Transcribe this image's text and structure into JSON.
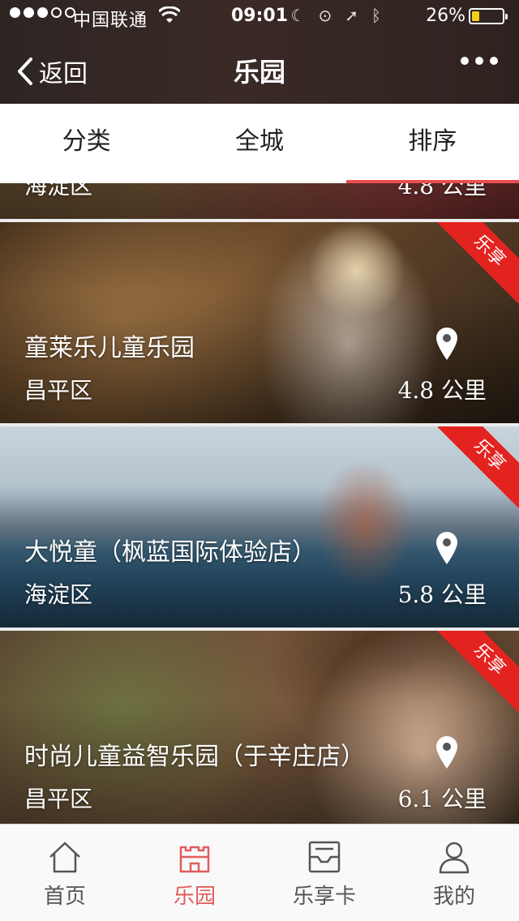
{
  "status_bar": {
    "carrier": "中国联通",
    "time": "09:01",
    "battery": "26%",
    "battery_level": 0.26
  },
  "nav": {
    "back_label": "返回",
    "title": "乐园"
  },
  "filters": {
    "items": [
      {
        "label": "分类"
      },
      {
        "label": "全城"
      },
      {
        "label": "排序"
      }
    ],
    "active_index": 2
  },
  "list": {
    "partial_item": {
      "district": "海淀区",
      "distance": "4.8 公里"
    },
    "items": [
      {
        "name": "童莱乐儿童乐园",
        "district": "昌平区",
        "distance": "4.8 公里",
        "badge": "乐享"
      },
      {
        "name": "大悦童（枫蓝国际体验店）",
        "district": "海淀区",
        "distance": "5.8 公里",
        "badge": "乐享"
      },
      {
        "name": "时尚儿童益智乐园（于辛庄店）",
        "district": "昌平区",
        "distance": "6.1 公里",
        "badge": "乐享"
      }
    ]
  },
  "tabbar": {
    "items": [
      {
        "label": "首页",
        "icon": "home-icon"
      },
      {
        "label": "乐园",
        "icon": "castle-icon"
      },
      {
        "label": "乐享卡",
        "icon": "card-box-icon"
      },
      {
        "label": "我的",
        "icon": "user-icon"
      }
    ],
    "active_index": 1
  },
  "colors": {
    "accent": "#e25c5c",
    "badge_red": "#e32320",
    "header_bg": "#2d2522"
  }
}
